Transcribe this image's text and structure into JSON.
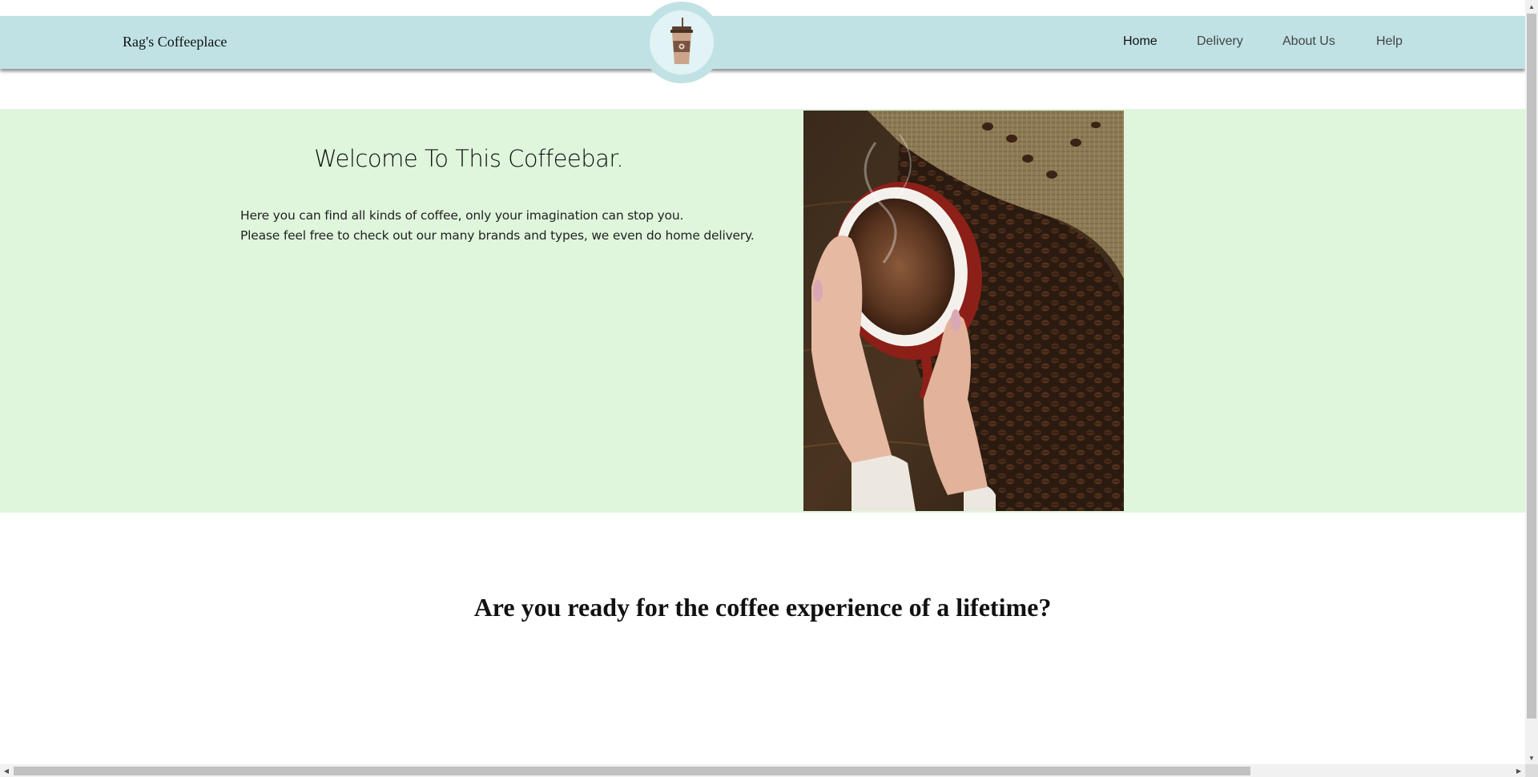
{
  "header": {
    "brand": "Rag's Coffeeplace",
    "logo_icon": "coffee-cup-icon",
    "nav": [
      {
        "label": "Home",
        "active": true
      },
      {
        "label": "Delivery",
        "active": false
      },
      {
        "label": "About Us",
        "active": false
      },
      {
        "label": "Help",
        "active": false
      }
    ],
    "bg_color": "#c0e2e4"
  },
  "hero": {
    "title": "Welcome To This Coffeebar.",
    "line1": "Here you can find all kinds of coffee, only your imagination can stop you.",
    "line2": "Please feel free to check out our many brands and types, we even do home delivery.",
    "bg_color": "#dff6dd"
  },
  "tagline": "Are you ready for the coffee experience of a lifetime?"
}
